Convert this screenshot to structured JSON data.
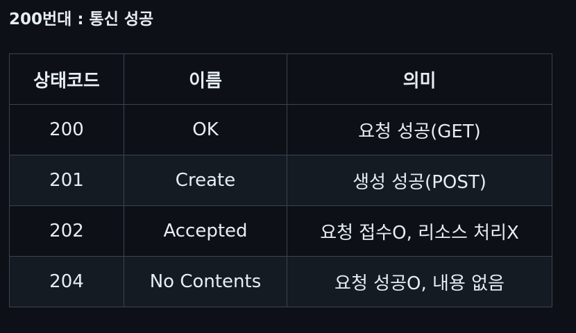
{
  "heading": "200번대 : 통신 성공",
  "table": {
    "headers": [
      "상태코드",
      "이름",
      "의미"
    ],
    "rows": [
      [
        "200",
        "OK",
        "요청 성공(GET)"
      ],
      [
        "201",
        "Create",
        "생성 성공(POST)"
      ],
      [
        "202",
        "Accepted",
        "요청 접수O, 리소스 처리X"
      ],
      [
        "204",
        "No Contents",
        "요청 성공O, 내용 없음"
      ]
    ]
  },
  "colors": {
    "background": "#0d1117",
    "row_alt": "#151b23",
    "border": "#3d444d",
    "text": "#e6edf3"
  }
}
